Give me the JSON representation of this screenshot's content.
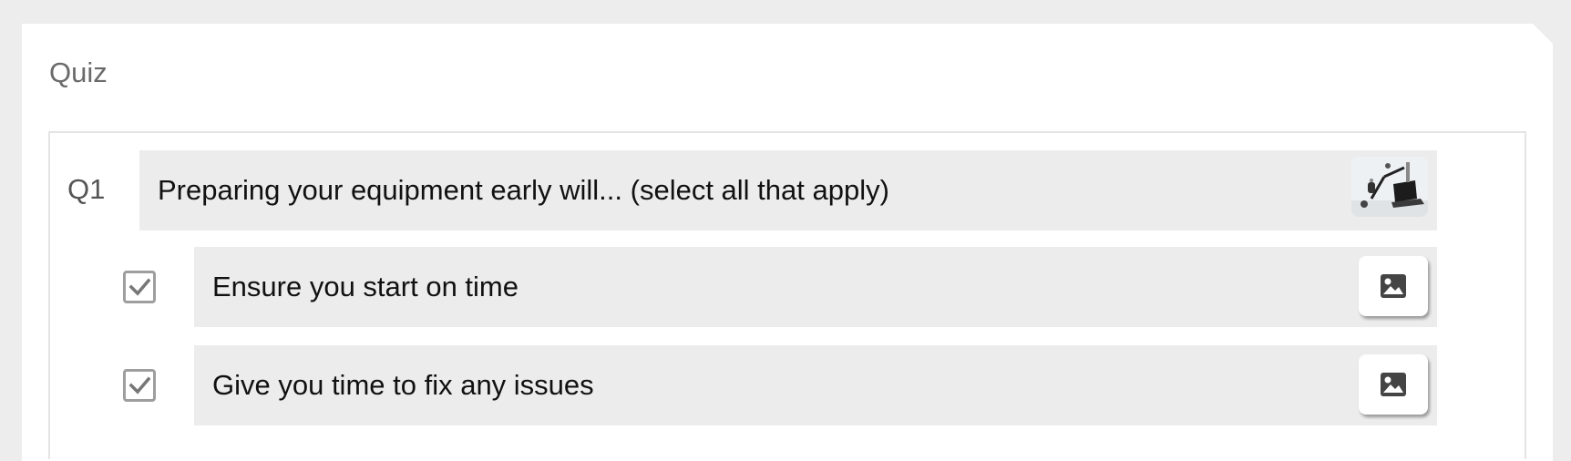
{
  "page": {
    "title": "Quiz"
  },
  "question": {
    "number": "Q1",
    "text": "Preparing your equipment early will... (select all that apply)",
    "thumbnail_icon": "microphone-laptop-photo"
  },
  "answers": [
    {
      "text": "Ensure you start on time",
      "checked": true,
      "image_icon": "image-icon"
    },
    {
      "text": "Give you time to fix any issues",
      "checked": true,
      "image_icon": "image-icon"
    }
  ],
  "colors": {
    "background": "#ededed",
    "bar": "#ececec",
    "checkbox_border": "#9e9e9e",
    "text": "#111111"
  }
}
